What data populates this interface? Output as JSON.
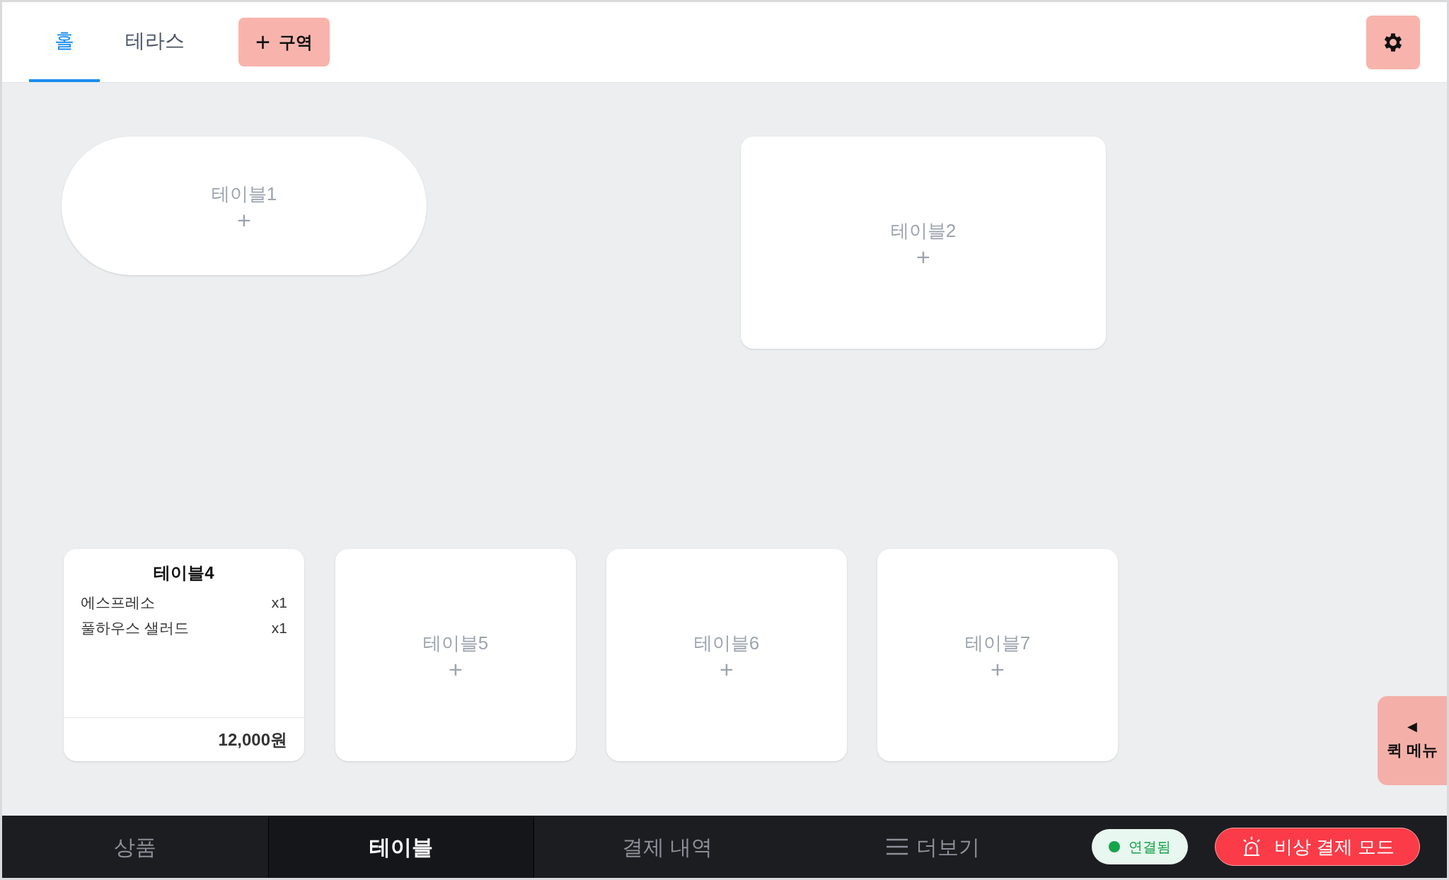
{
  "zone_tabs": [
    {
      "label": "홀",
      "selected": true
    },
    {
      "label": "테라스",
      "selected": false
    }
  ],
  "add_zone_button": {
    "icon": "+",
    "label": "구역"
  },
  "tables": [
    {
      "name": "테이블1",
      "kind": "empty",
      "pill": true,
      "add": "+"
    },
    {
      "name": "테이블2",
      "kind": "empty",
      "pill": false,
      "add": "+"
    },
    {
      "name": "테이블4",
      "kind": "occupied",
      "pill": false,
      "items": [
        {
          "name": "에스프레소",
          "qty": "x1"
        },
        {
          "name": "풀하우스 샐러드",
          "qty": "x1"
        }
      ],
      "total": "12,000원"
    },
    {
      "name": "테이블5",
      "kind": "empty",
      "pill": false,
      "add": "+"
    },
    {
      "name": "테이블6",
      "kind": "empty",
      "pill": false,
      "add": "+"
    },
    {
      "name": "테이블7",
      "kind": "empty",
      "pill": false,
      "add": "+"
    }
  ],
  "quick_menu": {
    "arrow": "◀",
    "label": "퀵 메뉴"
  },
  "bottom_nav": [
    {
      "label": "상품",
      "selected": false,
      "kind": "plain"
    },
    {
      "label": "테이블",
      "selected": true,
      "kind": "plain"
    },
    {
      "label": "결제 내역",
      "selected": false,
      "kind": "plain"
    },
    {
      "label": "더보기",
      "selected": false,
      "kind": "menu"
    }
  ],
  "connection": {
    "label": "연결됨",
    "connected": true
  },
  "emergency_button": {
    "label": "비상 결제 모드"
  }
}
